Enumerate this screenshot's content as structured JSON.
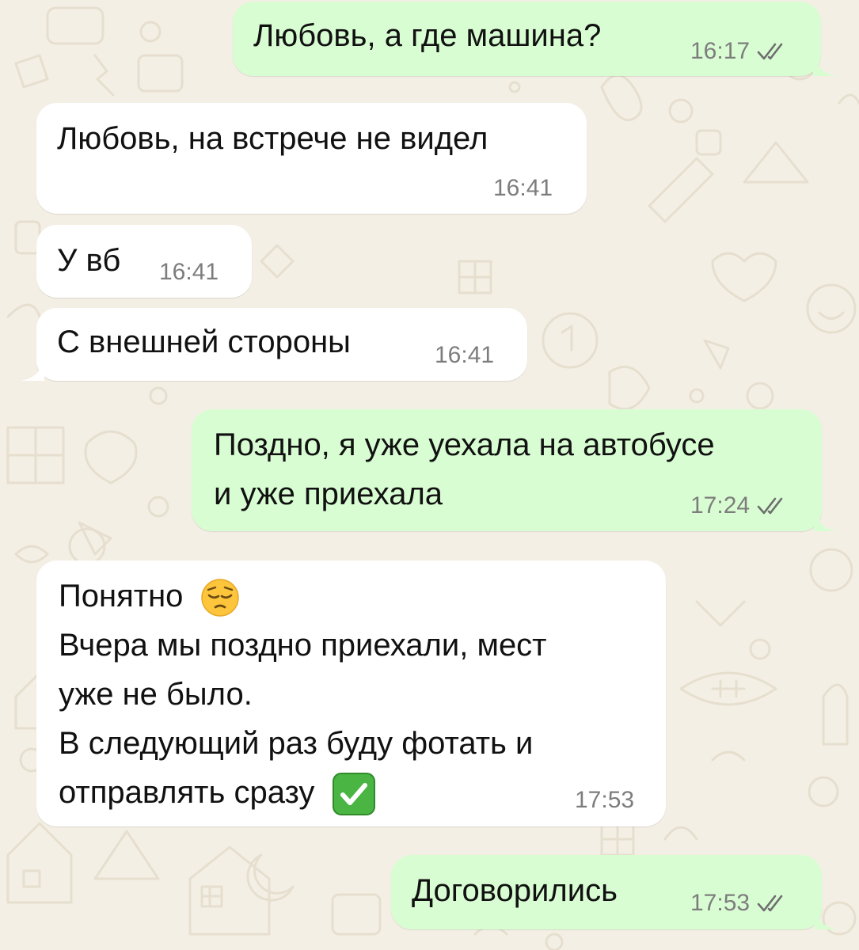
{
  "colors": {
    "outgoing_bubble": "#d9fdd3",
    "incoming_bubble": "#ffffff",
    "wallpaper": "#f4efe4",
    "timestamp": "#7d7d7d",
    "read_ticks": "#6e6e6e"
  },
  "messages": [
    {
      "direction": "outgoing",
      "text": "Любовь, а где машина?",
      "time": "16:17",
      "status_icon": "double-check-icon"
    },
    {
      "direction": "incoming",
      "text": "Любовь, на встрече не видел",
      "time": "16:41"
    },
    {
      "direction": "incoming",
      "text": "У вб",
      "time": "16:41"
    },
    {
      "direction": "incoming",
      "text": "С внешней стороны",
      "time": "16:41"
    },
    {
      "direction": "outgoing",
      "text": "Поздно, я уже уехала на автобусе\nи уже приехала",
      "time": "17:24",
      "status_icon": "double-check-icon"
    },
    {
      "direction": "incoming",
      "lines": [
        "Понятно",
        "Вчера мы поздно приехали, мест",
        "уже не было.",
        "В следующий раз буду фотать и",
        "отправлять сразу"
      ],
      "emojis": [
        "pensive-face-emoji",
        "check-mark-button-emoji"
      ],
      "time": "17:53"
    },
    {
      "direction": "outgoing",
      "text": "Договорились",
      "time": "17:53",
      "status_icon": "double-check-icon"
    }
  ]
}
